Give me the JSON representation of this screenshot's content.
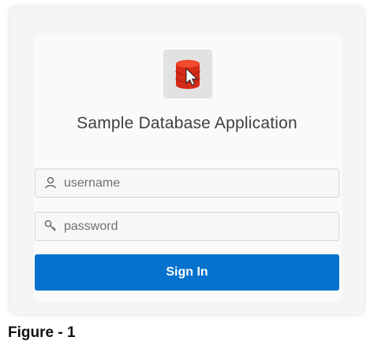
{
  "app": {
    "title": "Sample Database Application",
    "logo_icon": "database-cursor-icon",
    "logo_color": "#e2321c"
  },
  "form": {
    "username": {
      "placeholder": "username",
      "value": "",
      "icon": "user-icon"
    },
    "password": {
      "placeholder": "password",
      "value": "",
      "icon": "key-icon"
    },
    "submit_label": "Sign In",
    "submit_color": "#0572ce"
  },
  "caption": "Figure - 1"
}
